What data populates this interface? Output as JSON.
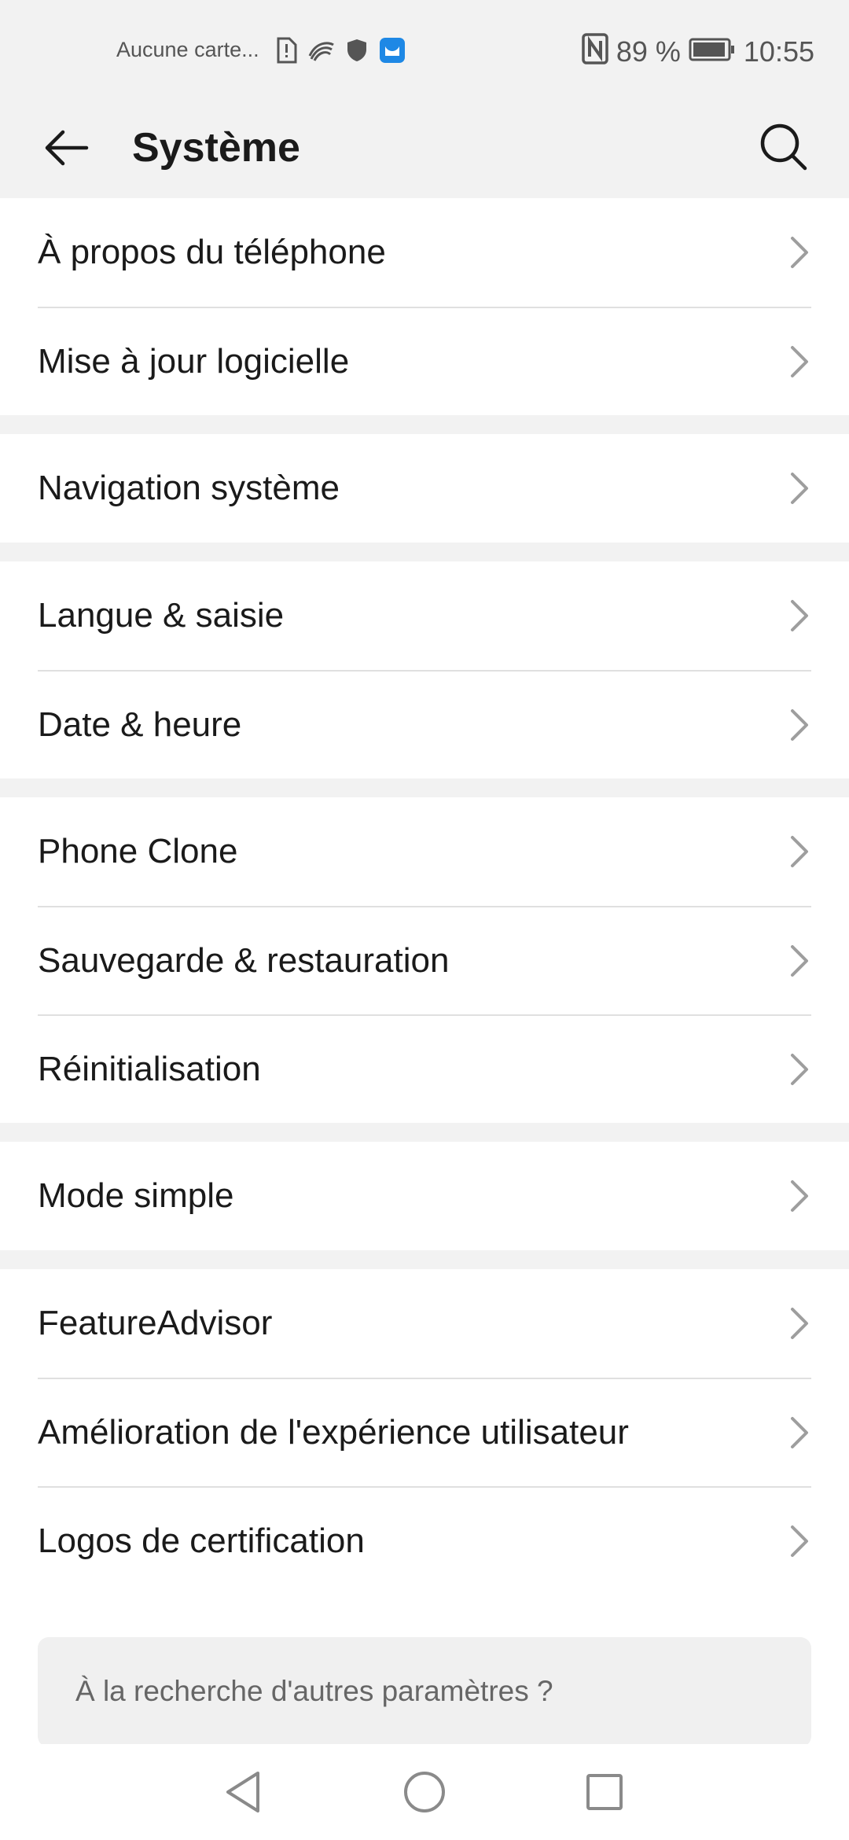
{
  "status_bar": {
    "carrier": "Aucune carte...",
    "battery_text": "89 %",
    "time": "10:55",
    "left_icons": [
      "sim-alert-icon",
      "swiftkey-icon",
      "shield-icon",
      "app-badge-icon"
    ],
    "right_icons": [
      "nfc-icon",
      "battery-icon"
    ]
  },
  "header": {
    "title": "Système"
  },
  "groups": [
    {
      "items": [
        "À propos du téléphone",
        "Mise à jour logicielle"
      ]
    },
    {
      "items": [
        "Navigation système"
      ]
    },
    {
      "items": [
        "Langue & saisie",
        "Date & heure"
      ]
    },
    {
      "items": [
        "Phone Clone",
        "Sauvegarde & restauration",
        "Réinitialisation"
      ]
    },
    {
      "items": [
        "Mode simple"
      ]
    },
    {
      "items": [
        "FeatureAdvisor",
        "Amélioration de l'expérience utilisateur",
        "Logos de certification"
      ]
    }
  ],
  "footer": {
    "more_settings": "À la recherche d'autres paramètres ?"
  },
  "colors": {
    "background": "#f2f2f2",
    "card": "#ffffff",
    "divider": "#e0e0e0",
    "text": "#1a1a1a",
    "secondary_text": "#666666",
    "app_badge": "#1e88e5"
  }
}
